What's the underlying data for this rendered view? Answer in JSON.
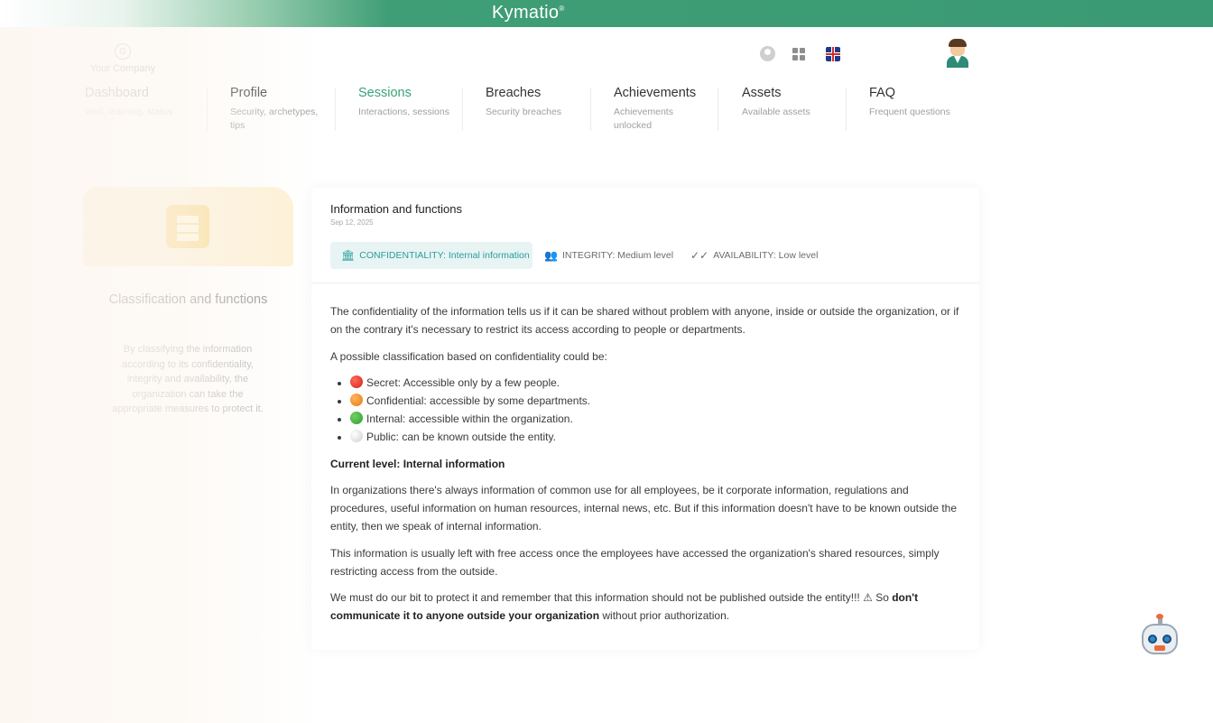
{
  "brand": {
    "name": "Kymatio",
    "mark": "®"
  },
  "company": {
    "name": "Your Company",
    "logo_glyph": "G"
  },
  "header_icons": [
    "user-icon",
    "apps-icon",
    "uk-flag-icon",
    "avatar"
  ],
  "nav": {
    "items": [
      {
        "title": "Dashboard",
        "sub": "Well, learning, status",
        "state": "faded"
      },
      {
        "title": "Profile",
        "sub": "Security, archetypes, tips",
        "state": "normal"
      },
      {
        "title": "Sessions",
        "sub": "Interactions, sessions",
        "state": "active"
      },
      {
        "title": "Breaches",
        "sub": "Security breaches",
        "state": "normal"
      },
      {
        "title": "Achievements",
        "sub": "Achievements unlocked",
        "state": "normal"
      },
      {
        "title": "Assets",
        "sub": "Available assets",
        "state": "normal"
      },
      {
        "title": "FAQ",
        "sub": "Frequent questions",
        "state": "normal"
      }
    ]
  },
  "left": {
    "title": "Classification and functions",
    "desc": "By classifying the information according to its confidentiality, integrity and availability, the organization can take the appropriate measures to protect it."
  },
  "panel": {
    "title": "Information and functions",
    "date": "Sep 12, 2025",
    "tabs": [
      {
        "label": "CONFIDENTIALITY: Internal information",
        "icon": "building-icon"
      },
      {
        "label": "INTEGRITY: Medium level",
        "icon": "users-icon"
      },
      {
        "label": "AVAILABILITY: Low level",
        "icon": "double-check-icon"
      }
    ],
    "p1": "The confidentiality of the information tells us if it can be shared without problem with anyone, inside or outside the organization, or if on the contrary it's necessary to restrict its access according to people or departments.",
    "p2": "A possible classification based on confidentiality could be:",
    "list": [
      "Secret: Accessible only by a few people.",
      "Confidential: accessible by some departments.",
      "Internal: accessible within the organization.",
      "Public: can be known outside the entity."
    ],
    "current_level": "Current level: Internal information",
    "p3": "In organizations there's always information of common use for all employees, be it corporate information, regulations and procedures, useful information on human resources, internal news, etc. But if this information doesn't have to be known outside the entity, then we speak of internal information.",
    "p4": "This information is usually left with free access once the employees have accessed the organization's shared resources, simply restricting access from the outside.",
    "p5_start": "We must do our bit to protect it and remember that this information should not be published outside the entity!!! ⚠ So",
    "p5_bold": "don't communicate it to anyone outside your organization",
    "p5_end": "without prior authorization."
  },
  "colors": {
    "brand_green": "#3a9a73",
    "active_tab": "#2b9c9c",
    "left_card": "#fdf0d4"
  }
}
